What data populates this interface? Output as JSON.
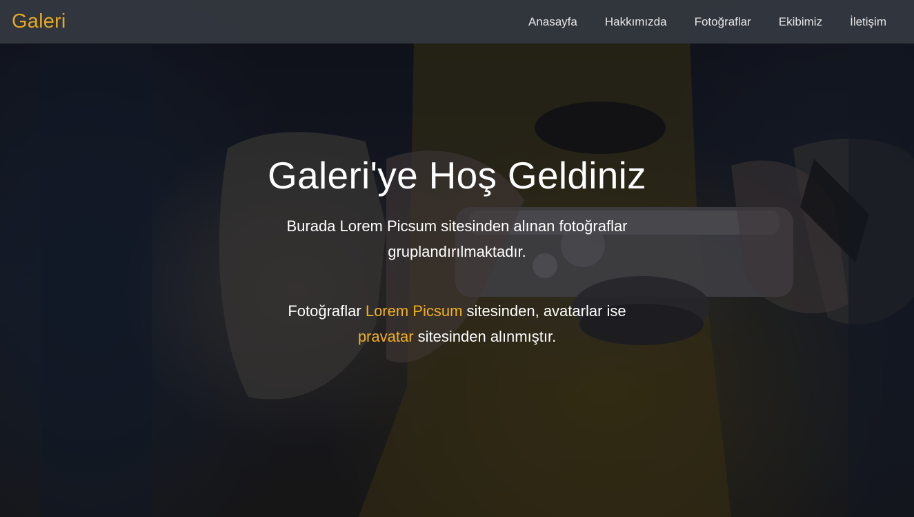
{
  "navbar": {
    "brand": "Galeri",
    "links": [
      "Anasayfa",
      "Hakkımızda",
      "Fotoğraflar",
      "Ekibimiz",
      "İletişim"
    ]
  },
  "hero": {
    "title": "Galeri'ye Hoş Geldiniz",
    "lead": "Burada Lorem Picsum sitesinden alınan fotoğraflar gruplandırılmaktadır.",
    "credits": {
      "prefix": "Fotoğraflar ",
      "link1": "Lorem Picsum",
      "middle": " sitesinden, avatarlar ise ",
      "link2": "pravatar",
      "suffix": " sitesinden alınmıştır."
    }
  },
  "colors": {
    "brand": "#e5a823",
    "accent_link": "#f2b01e",
    "navbar_bg": "#34383f",
    "text": "#ffffff"
  },
  "background_image": "dark photo of hands holding a vintage silver camera"
}
